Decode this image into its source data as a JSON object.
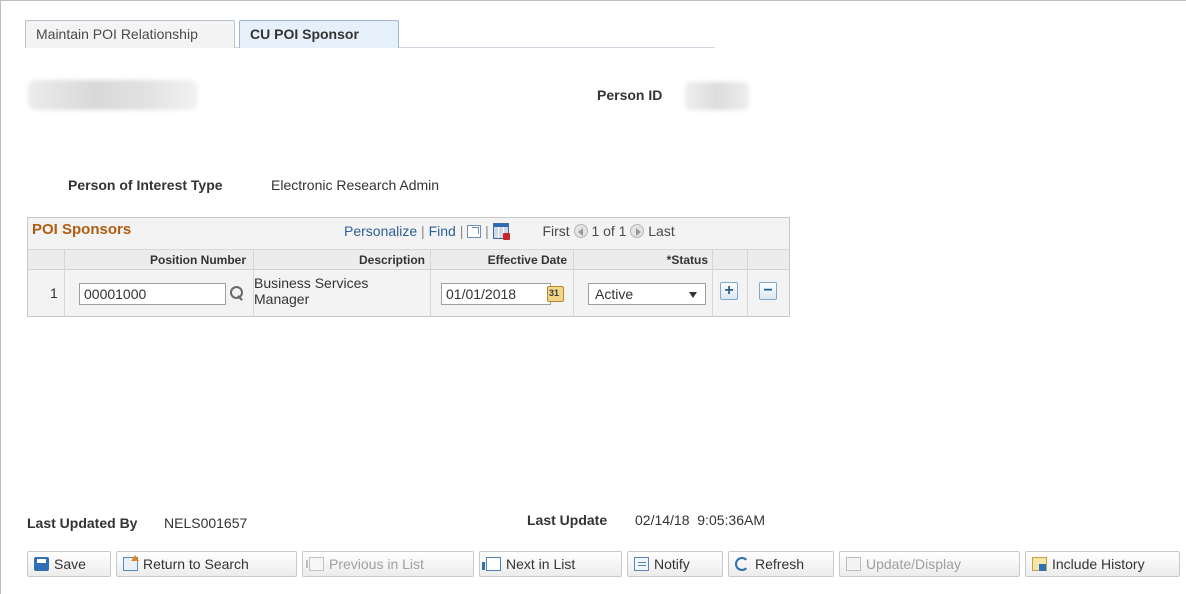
{
  "tabs": [
    {
      "label": "Maintain POI Relationship",
      "active": false
    },
    {
      "label": "CU POI Sponsor",
      "active": true
    }
  ],
  "header": {
    "person_id_label": "Person ID",
    "poi_type_label": "Person of Interest Type",
    "poi_type_value": "Electronic Research Admin"
  },
  "grid": {
    "title": "POI Sponsors",
    "personalize": "Personalize",
    "find": "Find",
    "first": "First",
    "range": "1 of 1",
    "last": "Last",
    "columns": {
      "position_number": "Position Number",
      "description": "Description",
      "effective_date": "Effective Date",
      "status": "*Status"
    },
    "rows": [
      {
        "num": "1",
        "position_number": "00001000",
        "description": "Business Services Manager",
        "effective_date": "01/01/2018",
        "status": "Active"
      }
    ]
  },
  "footer": {
    "last_updated_by_label": "Last Updated By",
    "last_updated_by_value": "NELS001657",
    "last_update_label": "Last Update",
    "last_update_value": "02/14/18  9:05:36AM"
  },
  "toolbar": {
    "save": "Save",
    "return_to_search": "Return to Search",
    "previous_in_list": "Previous in List",
    "next_in_list": "Next in List",
    "notify": "Notify",
    "refresh": "Refresh",
    "update_display": "Update/Display",
    "include_history": "Include History"
  }
}
